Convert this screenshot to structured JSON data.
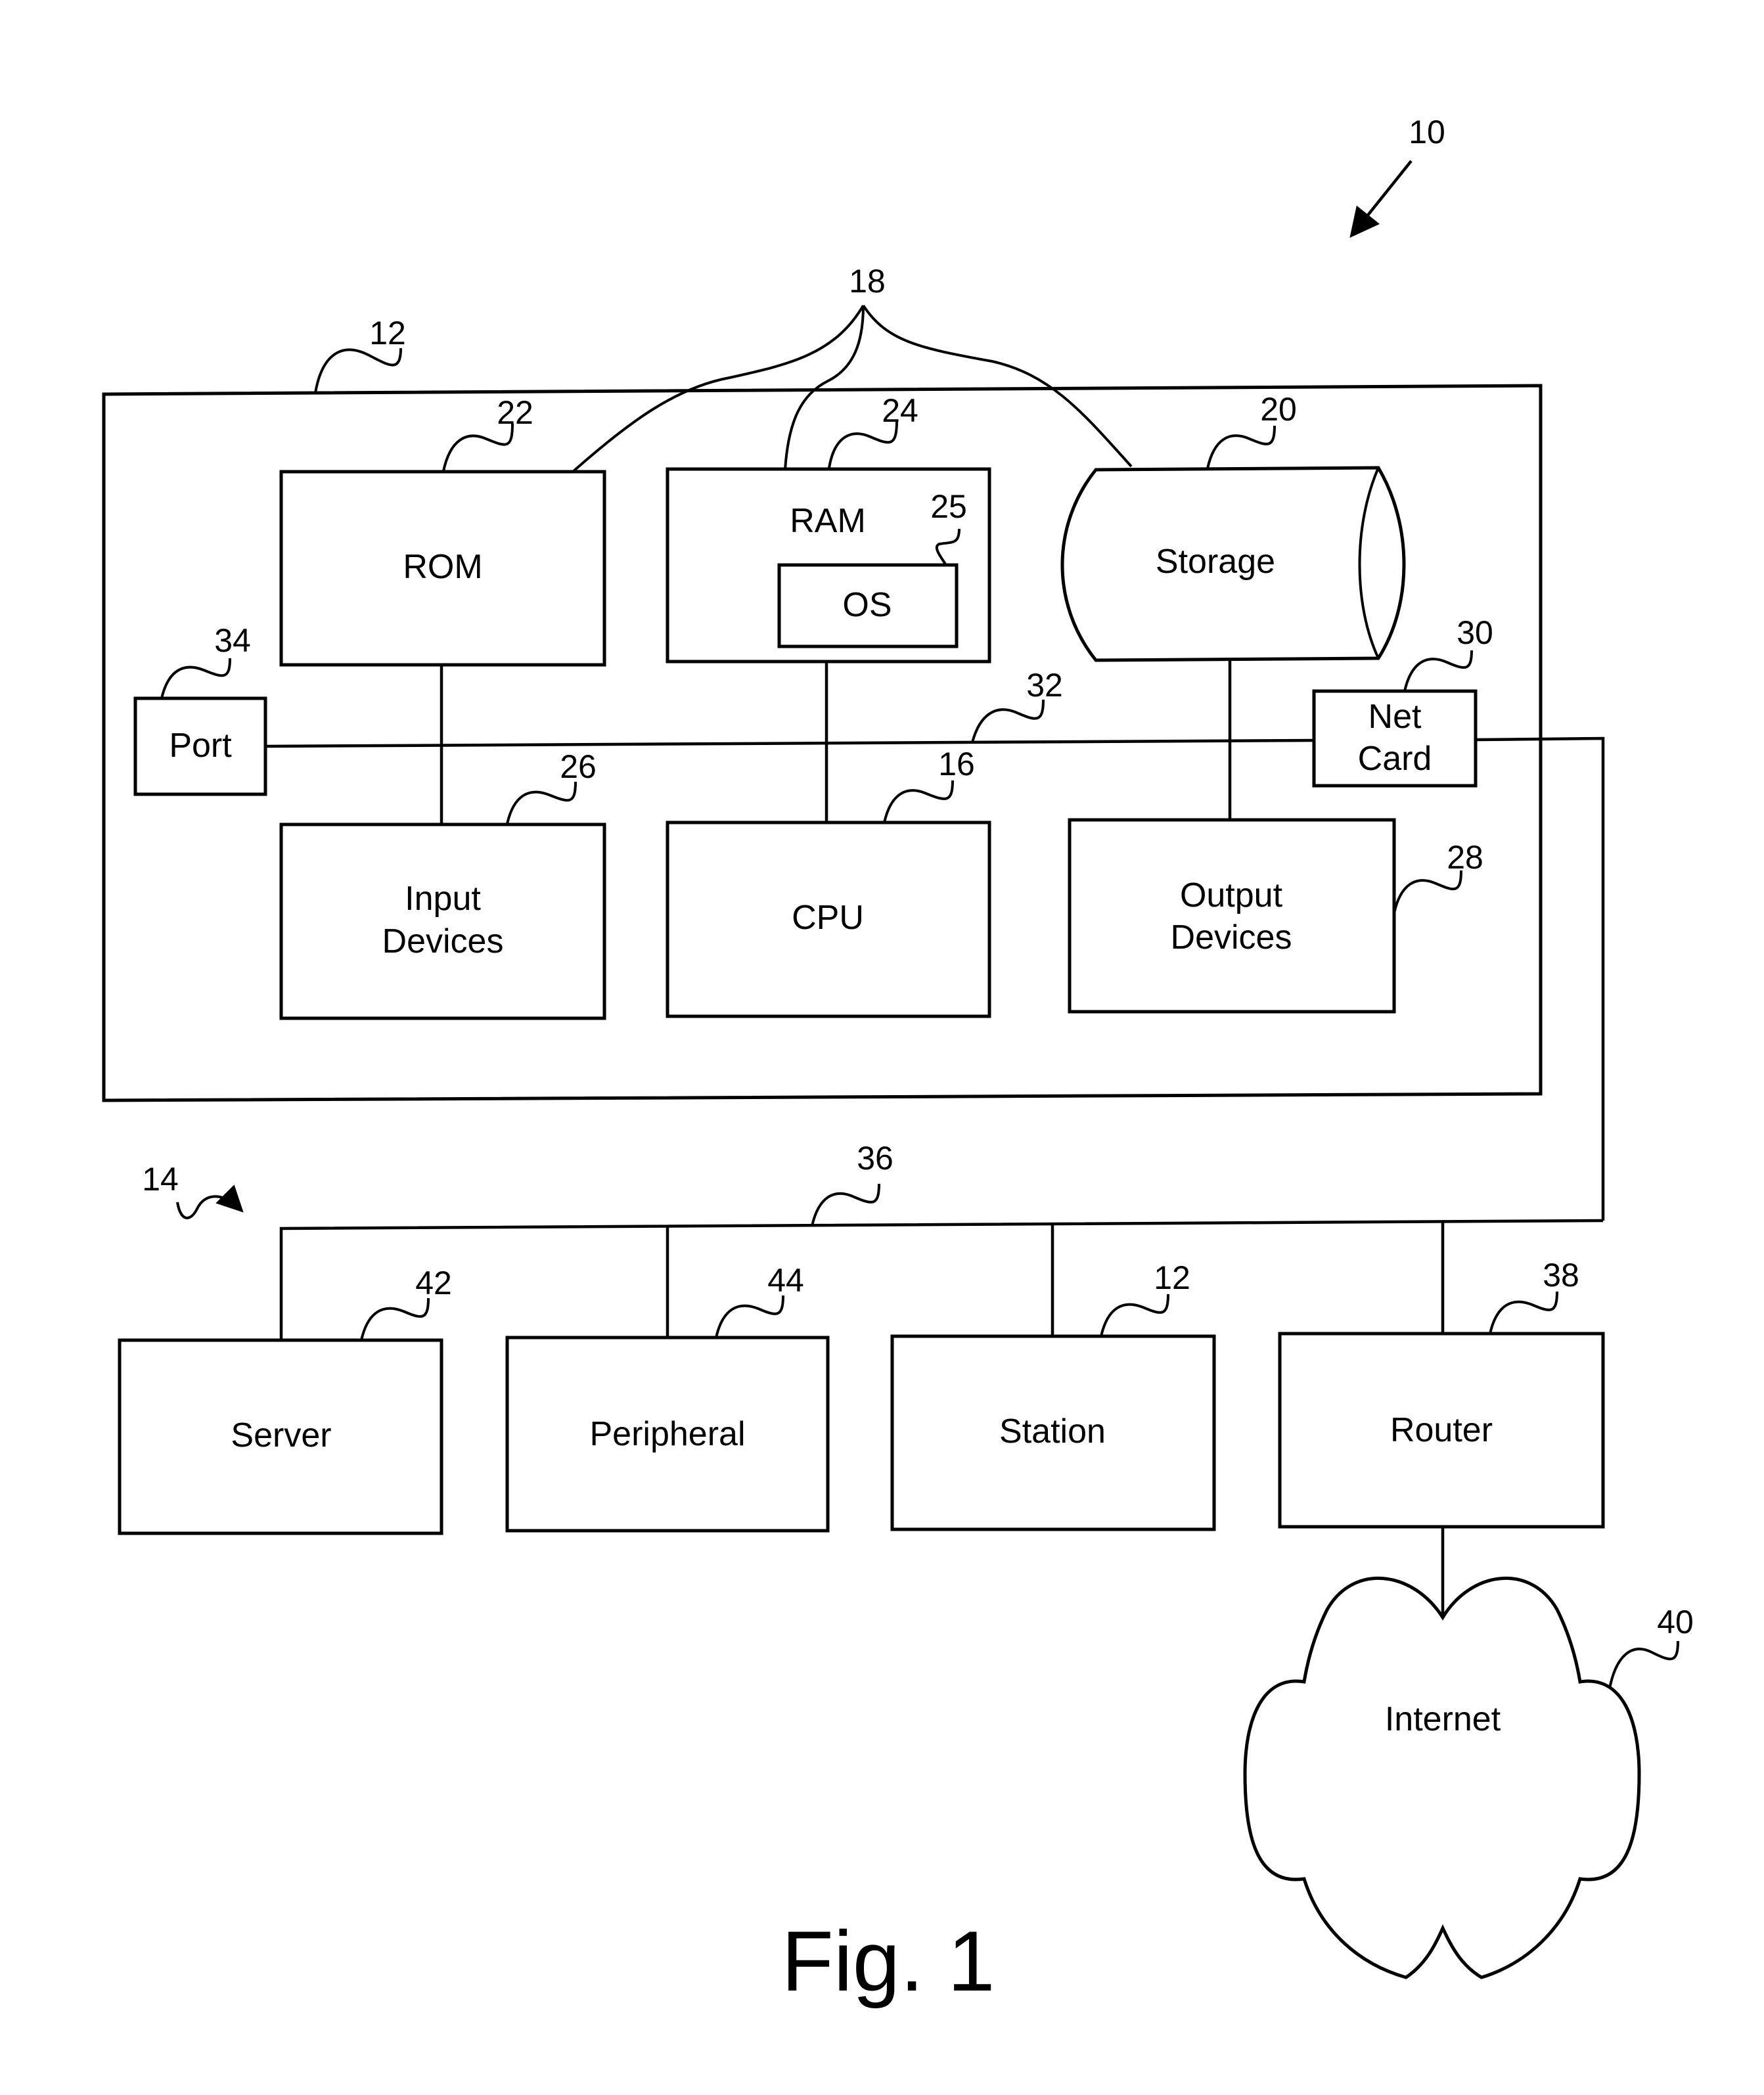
{
  "figure": {
    "caption": "Fig. 1",
    "system_ref": "10",
    "network_ref": "14"
  },
  "computer": {
    "ref": "12",
    "bus_group_ref": "18",
    "system_bus_ref": "32",
    "components": {
      "rom": {
        "label": "ROM",
        "ref": "22"
      },
      "ram": {
        "label": "RAM",
        "ref": "24"
      },
      "os": {
        "label": "OS",
        "ref": "25"
      },
      "storage": {
        "label": "Storage",
        "ref": "20"
      },
      "port": {
        "label": "Port",
        "ref": "34"
      },
      "net_card": {
        "label_line1": "Net",
        "label_line2": "Card",
        "ref": "30"
      },
      "input_devices": {
        "label_line1": "Input",
        "label_line2": "Devices",
        "ref": "26"
      },
      "cpu": {
        "label": "CPU",
        "ref": "16"
      },
      "output_devices": {
        "label_line1": "Output",
        "label_line2": "Devices",
        "ref": "28"
      }
    }
  },
  "network": {
    "bus_ref": "36",
    "nodes": {
      "server": {
        "label": "Server",
        "ref": "42"
      },
      "peripheral": {
        "label": "Peripheral",
        "ref": "44"
      },
      "station": {
        "label": "Station",
        "ref": "12"
      },
      "router": {
        "label": "Router",
        "ref": "38"
      }
    },
    "internet": {
      "label": "Internet",
      "ref": "40"
    }
  }
}
